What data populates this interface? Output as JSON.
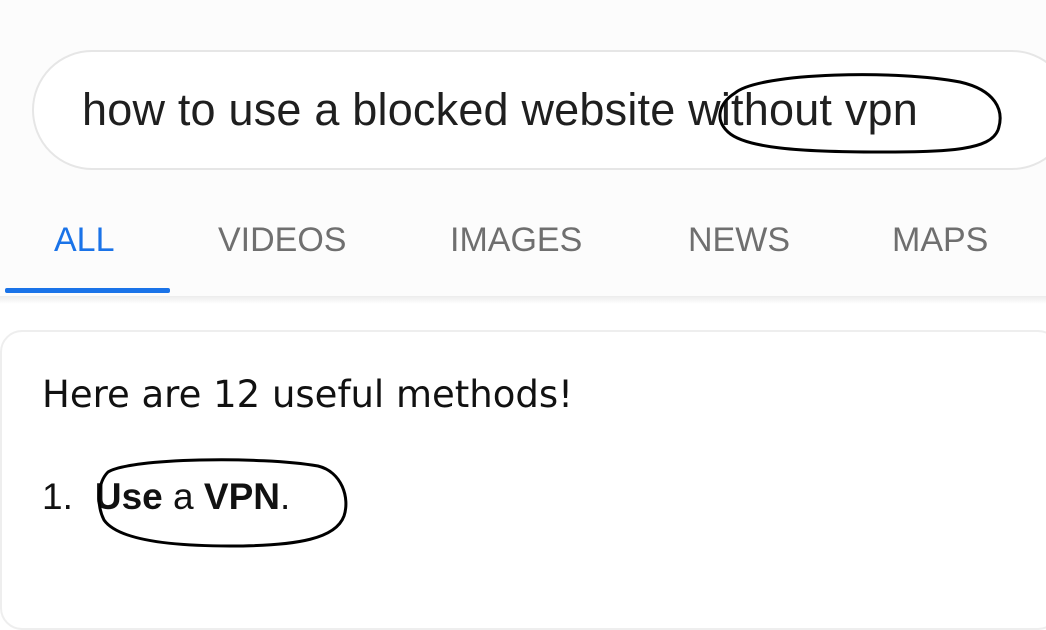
{
  "search": {
    "query": "how to use a blocked website without vpn"
  },
  "tabs": [
    {
      "label": "ALL"
    },
    {
      "label": "VIDEOS"
    },
    {
      "label": "IMAGES"
    },
    {
      "label": "NEWS"
    },
    {
      "label": "MAPS"
    }
  ],
  "result": {
    "heading": "Here are 12 useful methods!",
    "item_number": "1.",
    "item_text_part1": "Use",
    "item_text_part2": " a ",
    "item_text_part3": "VPN",
    "item_text_part4": "."
  },
  "colors": {
    "accent": "#1a73e8",
    "tab_inactive": "#6f6f6f",
    "annotation_ink": "#000000"
  }
}
